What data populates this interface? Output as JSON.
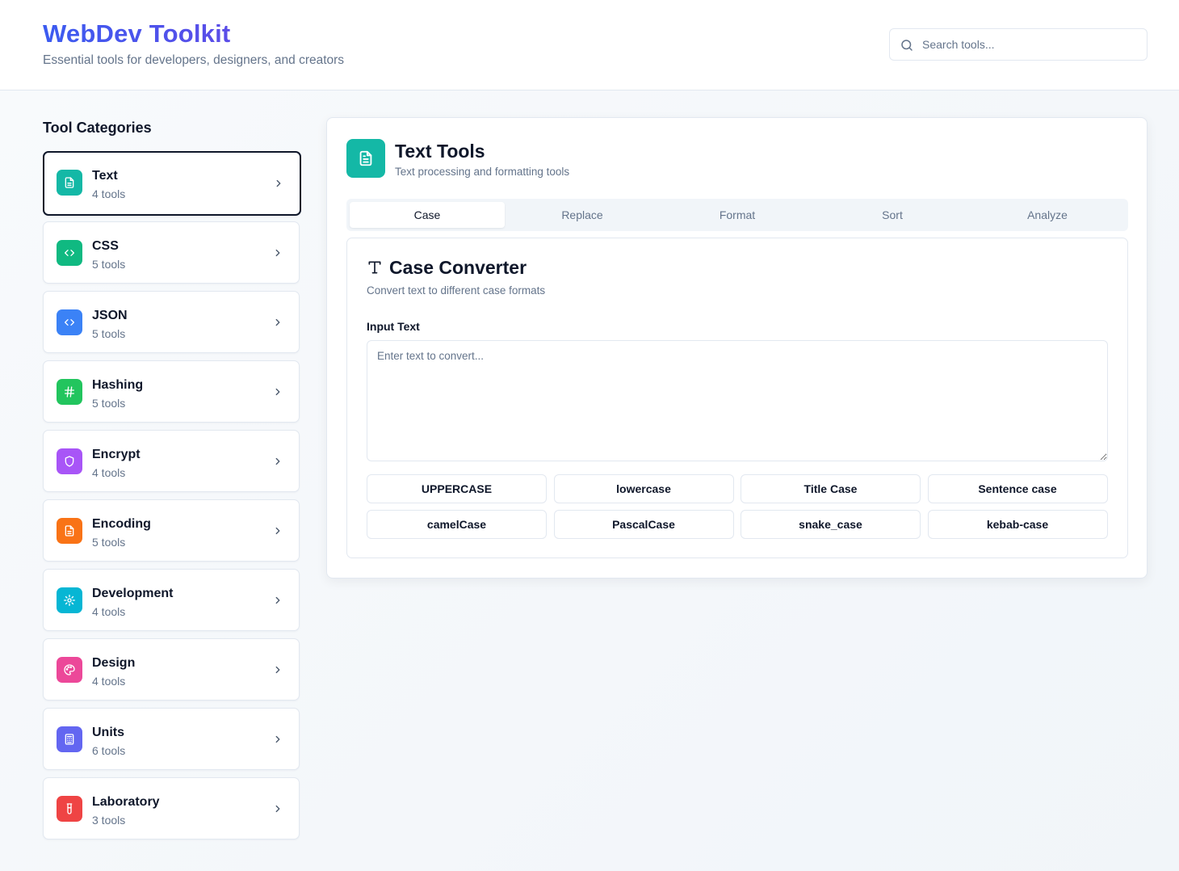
{
  "header": {
    "title": "WebDev Toolkit",
    "subtitle": "Essential tools for developers, designers, and creators",
    "search": {
      "placeholder": "Search tools...",
      "value": ""
    }
  },
  "sidebar": {
    "title": "Tool Categories",
    "items": [
      {
        "label": "Text",
        "count": "4 tools",
        "icon": "document-icon",
        "color": "#14b8a6",
        "active": true
      },
      {
        "label": "CSS",
        "count": "5 tools",
        "icon": "code-icon",
        "color": "#10b981"
      },
      {
        "label": "JSON",
        "count": "5 tools",
        "icon": "code-icon",
        "color": "#3b82f6"
      },
      {
        "label": "Hashing",
        "count": "5 tools",
        "icon": "hash-icon",
        "color": "#22c55e"
      },
      {
        "label": "Encrypt",
        "count": "4 tools",
        "icon": "shield-icon",
        "color": "#a855f7"
      },
      {
        "label": "Encoding",
        "count": "5 tools",
        "icon": "document-icon",
        "color": "#f97316"
      },
      {
        "label": "Development",
        "count": "4 tools",
        "icon": "gear-icon",
        "color": "#06b6d4"
      },
      {
        "label": "Design",
        "count": "4 tools",
        "icon": "palette-icon",
        "color": "#ec4899"
      },
      {
        "label": "Units",
        "count": "6 tools",
        "icon": "calculator-icon",
        "color": "#6366f1"
      },
      {
        "label": "Laboratory",
        "count": "3 tools",
        "icon": "flask-icon",
        "color": "#ef4444"
      }
    ]
  },
  "panel": {
    "title": "Text Tools",
    "subtitle": "Text processing and formatting tools",
    "icon_color": "#14b8a6",
    "tabs": [
      {
        "label": "Case",
        "active": true
      },
      {
        "label": "Replace"
      },
      {
        "label": "Format"
      },
      {
        "label": "Sort"
      },
      {
        "label": "Analyze"
      }
    ],
    "card": {
      "title": "Case Converter",
      "subtitle": "Convert text to different case formats",
      "input_label": "Input Text",
      "input_placeholder": "Enter text to convert...",
      "input_value": "",
      "buttons": [
        "UPPERCASE",
        "lowercase",
        "Title Case",
        "Sentence case",
        "camelCase",
        "PascalCase",
        "snake_case",
        "kebab-case"
      ]
    }
  }
}
